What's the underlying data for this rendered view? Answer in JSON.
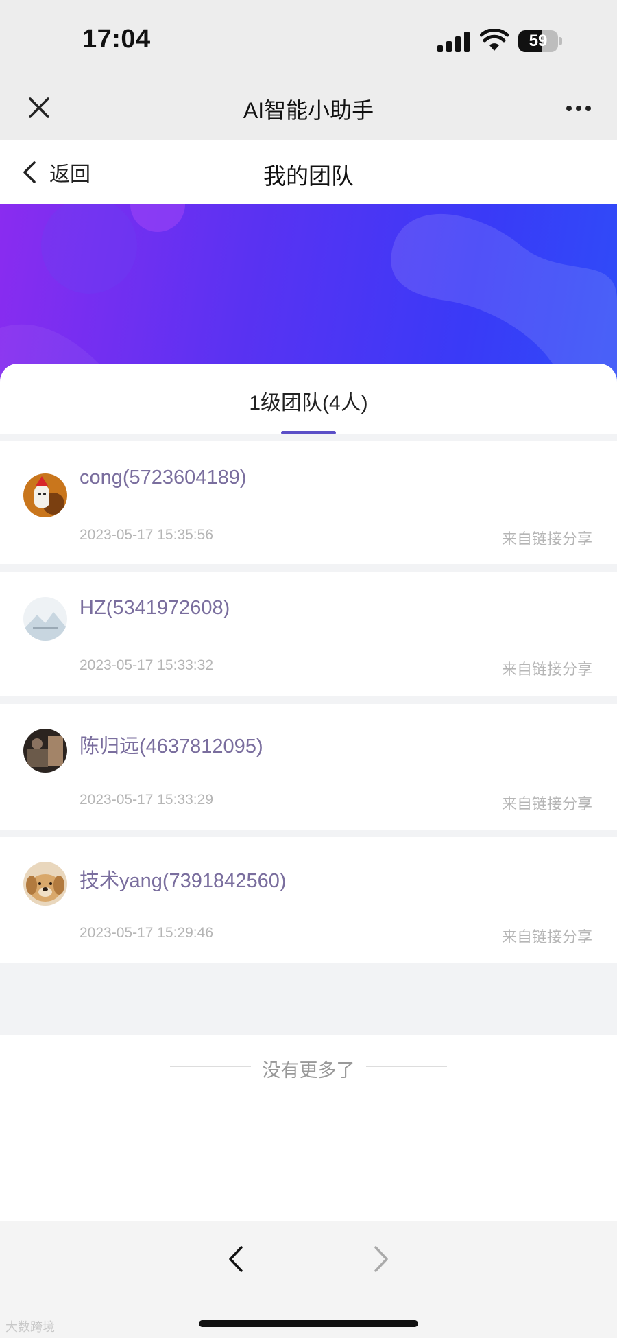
{
  "status_bar": {
    "time": "17:04",
    "battery": "59",
    "battery_level": 0.59
  },
  "title_bar": {
    "title": "AI智能小助手"
  },
  "page_nav": {
    "back_label": "返回",
    "title": "我的团队"
  },
  "tabs": [
    {
      "label": "1级团队(4人)",
      "active": true
    }
  ],
  "members": [
    {
      "name": "cong(5723604189)",
      "time": "2023-05-17 15:35:56",
      "source": "来自链接分享"
    },
    {
      "name": "HZ(5341972608)",
      "time": "2023-05-17 15:33:32",
      "source": "来自链接分享"
    },
    {
      "name": "陈归远(4637812095)",
      "time": "2023-05-17 15:33:29",
      "source": "来自链接分享"
    },
    {
      "name": "技术yang(7391842560)",
      "time": "2023-05-17 15:29:46",
      "source": "来自链接分享"
    }
  ],
  "footer": {
    "no_more": "没有更多了"
  },
  "watermark": "大数跨境",
  "colors": {
    "banner_start": "#8a2cf0",
    "banner_end": "#2f4cf8",
    "tab_underline": "#5b4fc7",
    "member_name": "#7a6e9e"
  }
}
